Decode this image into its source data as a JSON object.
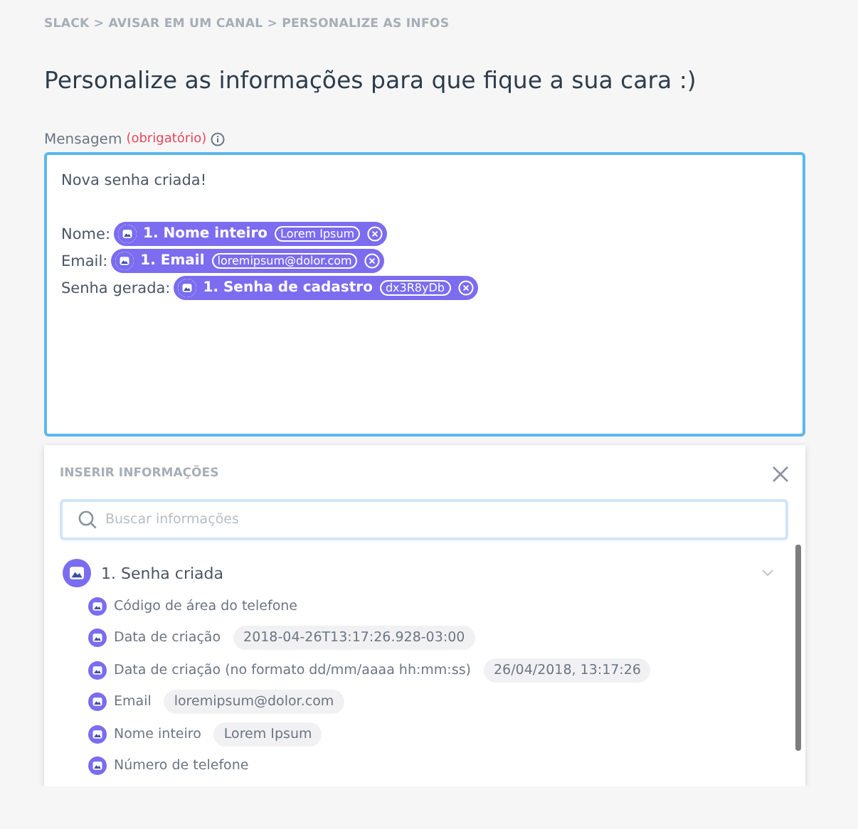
{
  "breadcrumb": "SLACK > AVISAR EM UM CANAL > PERSONALIZE AS INFOS",
  "title": "Personalize as informações para que fique a sua cara :)",
  "message_field": {
    "label": "Mensagem",
    "required_note": "(obrigatório)",
    "lines": [
      {
        "kind": "text",
        "text": "Nova senha criada!"
      },
      {
        "kind": "blank"
      },
      {
        "kind": "field",
        "text": "Nome:",
        "chip": "1. Nome inteiro",
        "value": "Lorem Ipsum"
      },
      {
        "kind": "field",
        "text": "Email:",
        "chip": "1. Email",
        "value": "loremipsum@dolor.com"
      },
      {
        "kind": "field",
        "text": "Senha gerada:",
        "chip": "1. Senha de cadastro",
        "value": "dx3R8yDb"
      }
    ]
  },
  "insert_panel": {
    "title": "INSERIR INFORMAÇÕES",
    "search": {
      "placeholder": "Buscar informações"
    },
    "groups": [
      {
        "label": "1. Senha criada",
        "expanded": true,
        "children": [
          {
            "label": "Código de área do telefone"
          },
          {
            "label": "Data de criação",
            "value": "2018-04-26T13:17:26.928-03:00"
          },
          {
            "label": "Data de criação (no formato dd/mm/aaaa hh:mm:ss)",
            "value": "26/04/2018, 13:17:26"
          },
          {
            "label": "Email",
            "value": "loremipsum@dolor.com"
          },
          {
            "label": "Nome inteiro",
            "value": "Lorem Ipsum"
          },
          {
            "label": "Número de telefone"
          }
        ]
      }
    ]
  }
}
